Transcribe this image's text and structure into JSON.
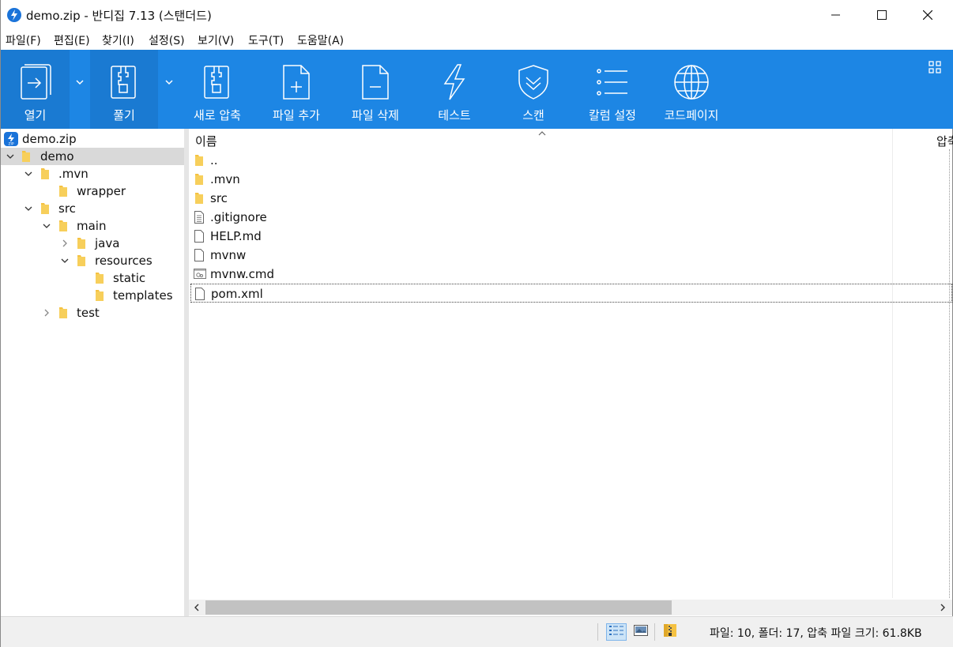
{
  "window": {
    "title": "demo.zip - 반디집 7.13 (스탠더드)"
  },
  "menu": [
    {
      "label": "파일(F)"
    },
    {
      "label": "편집(E)"
    },
    {
      "label": "찾기(I)"
    },
    {
      "label": "설정(S)"
    },
    {
      "label": "보기(V)"
    },
    {
      "label": "도구(T)"
    },
    {
      "label": "도움말(A)"
    }
  ],
  "toolbar": {
    "open": "열기",
    "extract": "풀기",
    "new_archive": "새로 압축",
    "add_file": "파일 추가",
    "delete_file": "파일 삭제",
    "test": "테스트",
    "scan": "스캔",
    "columns": "칼럼 설정",
    "codepage": "코드페이지"
  },
  "tree": [
    {
      "label": "demo.zip",
      "icon": "zip-archive-icon"
    },
    {
      "label": "demo",
      "expanded": true,
      "selected": true
    },
    {
      "label": ".mvn",
      "expanded": true
    },
    {
      "label": "wrapper"
    },
    {
      "label": "src",
      "expanded": true
    },
    {
      "label": "main",
      "expanded": true
    },
    {
      "label": "java",
      "expanded": false
    },
    {
      "label": "resources",
      "expanded": true
    },
    {
      "label": "static"
    },
    {
      "label": "templates"
    },
    {
      "label": "test",
      "expanded": false
    }
  ],
  "list": {
    "columns": [
      "이름",
      "압축"
    ],
    "files": [
      {
        "name": "..",
        "icon": "folder-icon"
      },
      {
        "name": ".mvn",
        "icon": "folder-icon"
      },
      {
        "name": "src",
        "icon": "folder-icon"
      },
      {
        "name": ".gitignore",
        "icon": "text-file-icon"
      },
      {
        "name": "HELP.md",
        "icon": "blank-file-icon"
      },
      {
        "name": "mvnw",
        "icon": "blank-file-icon"
      },
      {
        "name": "mvnw.cmd",
        "icon": "script-file-icon"
      },
      {
        "name": "pom.xml",
        "icon": "blank-file-icon",
        "focused": true
      }
    ]
  },
  "status": {
    "summary": "파일: 10, 폴더: 17, 압축 파일 크기: 61.8KB"
  },
  "colors": {
    "toolbar_bg": "#1d86e4",
    "folder": "#f5c242",
    "selection": "#d9d9d9"
  }
}
